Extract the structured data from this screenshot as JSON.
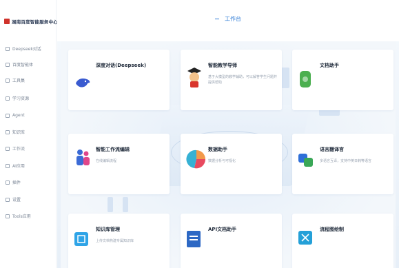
{
  "sidebar": {
    "logo_text": "湖南百度智能服务中心",
    "items": [
      {
        "label": "Deepseek对话",
        "active": false
      },
      {
        "label": "百度智能体",
        "active": false
      },
      {
        "label": "工具集",
        "active": false
      },
      {
        "label": "学习资源",
        "active": false
      },
      {
        "label": "Agent",
        "active": false
      },
      {
        "label": "知识库",
        "active": false
      },
      {
        "label": "工作流",
        "active": false
      },
      {
        "label": "AI应用",
        "active": false
      },
      {
        "label": "插件",
        "active": false
      },
      {
        "label": "设置",
        "active": false
      },
      {
        "label": "Tools应用",
        "active": false
      }
    ]
  },
  "header": {
    "title": "工作台"
  },
  "cards": [
    {
      "title": "深度对话(Deepseek)",
      "desc": ""
    },
    {
      "title": "智能教学导师",
      "desc": "基于大模型的教学辅助，可以解答学生问题并提供帮助"
    },
    {
      "title": "文档助手",
      "desc": ""
    },
    {
      "title": "智能工作流编辑",
      "desc": "在线编辑流程"
    },
    {
      "title": "数据助手",
      "desc": "数据分析与可视化"
    },
    {
      "title": "语言翻译官",
      "desc": "多语言互译，支持中英日韩等语言"
    },
    {
      "title": "知识库管理",
      "desc": "上传文档构建专属知识库"
    },
    {
      "title": "API文档助手",
      "desc": ""
    },
    {
      "title": "流程图绘制",
      "desc": ""
    }
  ]
}
